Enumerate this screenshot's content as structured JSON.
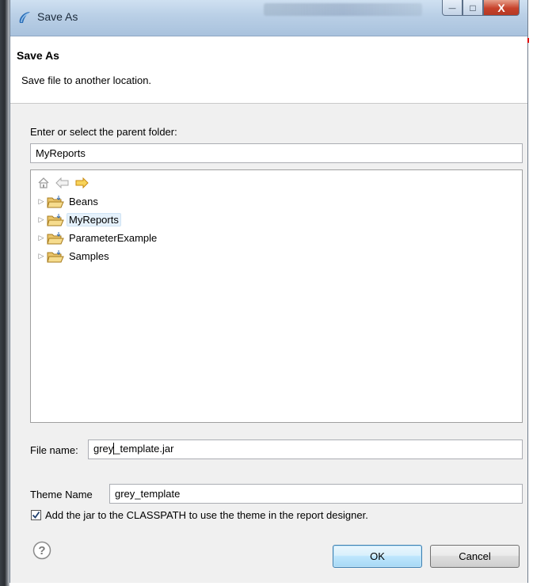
{
  "window": {
    "title": "Save As",
    "minimize_glyph": "—",
    "maximize_glyph": "□",
    "close_glyph": "X"
  },
  "header": {
    "title": "Save As",
    "description": "Save file to another location."
  },
  "folder": {
    "label": "Enter or select the parent folder:",
    "value": "MyReports"
  },
  "tree": {
    "toolbar_icons": [
      "home-icon",
      "back-arrow-icon",
      "forward-arrow-icon"
    ],
    "items": [
      {
        "label": "Beans",
        "selected": false
      },
      {
        "label": "MyReports",
        "selected": true
      },
      {
        "label": "ParameterExample",
        "selected": false
      },
      {
        "label": "Samples",
        "selected": false
      }
    ]
  },
  "file_name": {
    "label": "File name:",
    "value_before_caret": "grey",
    "value_after_caret": "_template.jar"
  },
  "theme_name": {
    "label": "Theme Name",
    "value": "grey_template"
  },
  "classpath": {
    "checked": true,
    "label": "Add the jar to the CLASSPATH to use the theme in the report designer."
  },
  "buttons": {
    "ok": "OK",
    "cancel": "Cancel"
  },
  "colors": {
    "title_bar": "#b9cfe6",
    "dialog_bg": "#f0f0f0",
    "default_button": "#bee6fd",
    "close_button": "#c7422b"
  }
}
